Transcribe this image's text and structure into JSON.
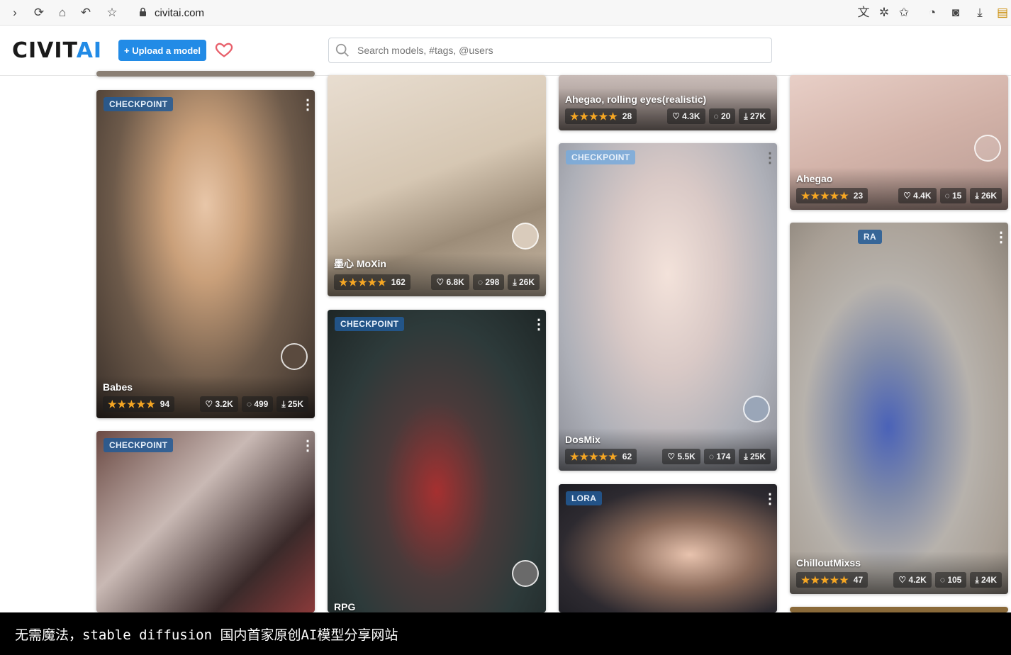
{
  "browser": {
    "url": "civitai.com"
  },
  "header": {
    "logo_main": "CIVIT",
    "logo_ai": "AI",
    "upload_label": "+ Upload a model",
    "search_placeholder": "Search models, #tags, @users"
  },
  "cards": [
    {
      "title": "",
      "rating_count": "",
      "likes": "",
      "comments": "",
      "downloads": ""
    },
    {
      "badge": "CHECKPOINT",
      "title": "Babes",
      "rating_count": "94",
      "likes": "3.2K",
      "comments": "499",
      "downloads": "25K"
    },
    {
      "badge": "CHECKPOINT"
    },
    {
      "title": "墨心 MoXin",
      "rating_count": "162",
      "likes": "6.8K",
      "comments": "298",
      "downloads": "26K"
    },
    {
      "badge": "CHECKPOINT",
      "title": "RPG"
    },
    {
      "title": "Ahegao, rolling eyes(realistic)",
      "rating_count": "28",
      "likes": "4.3K",
      "comments": "20",
      "downloads": "27K"
    },
    {
      "badge": "CHECKPOINT",
      "title": "DosMix",
      "rating_count": "62",
      "likes": "5.5K",
      "comments": "174",
      "downloads": "25K"
    },
    {
      "badge": "LORA"
    },
    {
      "title": "Ahegao",
      "rating_count": "23",
      "likes": "4.4K",
      "comments": "15",
      "downloads": "26K"
    },
    {
      "badge": "RA",
      "title": "ChilloutMixss",
      "rating_count": "47",
      "likes": "4.2K",
      "comments": "105",
      "downloads": "24K"
    }
  ],
  "caption": "无需魔法，stable diffusion 国内首家原创AI模型分享网站",
  "colors": {
    "accent": "#228be6",
    "star": "#f5a623",
    "badge": "#225a96"
  }
}
